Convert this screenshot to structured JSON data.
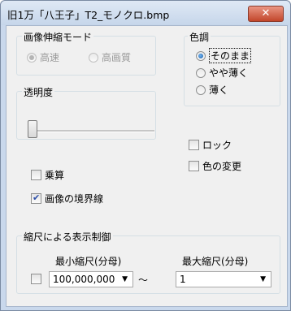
{
  "window": {
    "title": "旧1万「八王子」T2_モノクロ.bmp",
    "close_label": "✕"
  },
  "scale_mode": {
    "title": "画像伸縮モード",
    "options": [
      "高速",
      "高画質"
    ],
    "selected": "高速",
    "enabled": false
  },
  "tone": {
    "title": "色調",
    "options": [
      "そのまま",
      "やや薄く",
      "薄く"
    ],
    "selected": "そのまま"
  },
  "transparency": {
    "title": "透明度",
    "value": 0
  },
  "checkboxes": {
    "lock": {
      "label": "ロック",
      "checked": false
    },
    "multiply": {
      "label": "乗算",
      "checked": false
    },
    "color_change": {
      "label": "色の変更",
      "checked": false
    },
    "image_border": {
      "label": "画像の境界線",
      "checked": true
    }
  },
  "scale_control": {
    "title": "縮尺による表示制御",
    "enabled_checked": false,
    "min_label": "最小縮尺(分母)",
    "max_label": "最大縮尺(分母)",
    "min_value": "100,000,000",
    "max_value": "1",
    "separator": "～"
  }
}
